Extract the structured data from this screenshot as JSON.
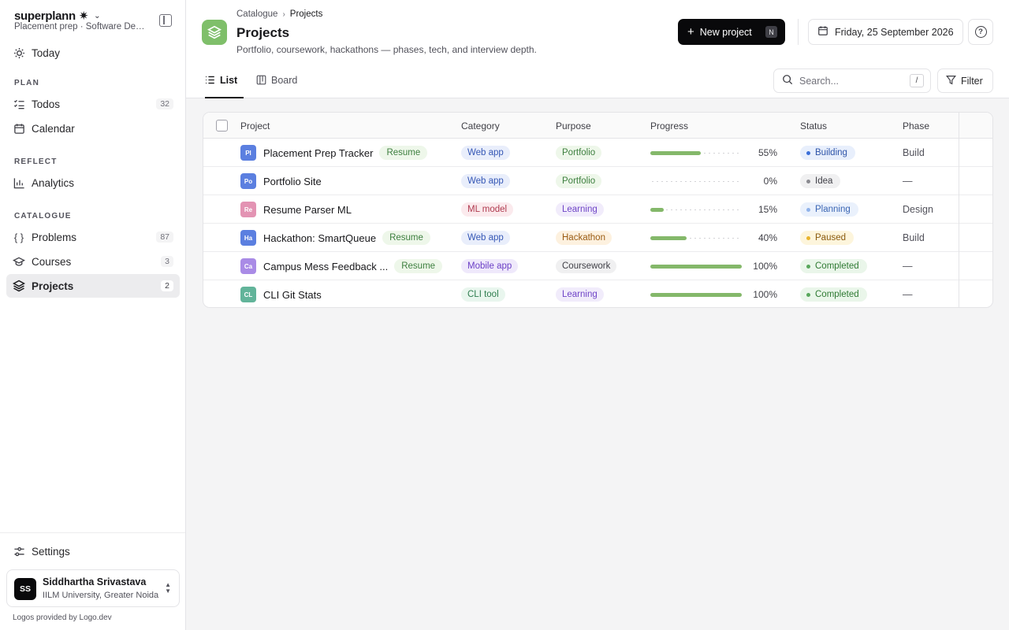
{
  "app": {
    "brand": "superplann",
    "workspace": "Placement prep · Software Development",
    "logos_note": "Logos provided by Logo.dev"
  },
  "sidebar": {
    "top": [
      {
        "label": "Today",
        "icon": "sun-icon"
      }
    ],
    "sections": [
      {
        "label": "PLAN",
        "items": [
          {
            "label": "Todos",
            "count": "32",
            "icon": "checklist-icon"
          },
          {
            "label": "Calendar",
            "count": "",
            "icon": "calendar-icon"
          }
        ]
      },
      {
        "label": "REFLECT",
        "items": [
          {
            "label": "Analytics",
            "count": "",
            "icon": "bar-chart-icon"
          }
        ]
      },
      {
        "label": "CATALOGUE",
        "items": [
          {
            "label": "Problems",
            "count": "87",
            "icon": "braces-icon"
          },
          {
            "label": "Courses",
            "count": "3",
            "icon": "graduation-cap-icon"
          },
          {
            "label": "Projects",
            "count": "2",
            "icon": "layers-icon",
            "active": true
          }
        ]
      }
    ],
    "settings": "Settings",
    "user": {
      "initials": "SS",
      "name": "Siddhartha Srivastava",
      "org": "IILM University, Greater Noida"
    }
  },
  "header": {
    "breadcrumb": [
      "Catalogue",
      "Projects"
    ],
    "title": "Projects",
    "subtitle": "Portfolio, coursework, hackathons — phases, tech, and interview depth.",
    "new_button": "New project",
    "new_shortcut": "N",
    "date": "Friday, 25 September 2026",
    "accent": "#7fbf6a"
  },
  "tabs": [
    {
      "label": "List",
      "active": true
    },
    {
      "label": "Board",
      "active": false
    }
  ],
  "search": {
    "placeholder": "Search...",
    "shortcut": "/"
  },
  "filter_label": "Filter",
  "table": {
    "columns": [
      "Project",
      "Category",
      "Purpose",
      "Progress",
      "Status",
      "Phase"
    ],
    "rows": [
      {
        "initials": "Pl",
        "tile_color": "#5b7fe0",
        "name": "Placement Prep Tracker",
        "resume": "Resume",
        "category": "Web app",
        "category_style": "webapp",
        "purpose": "Portfolio",
        "purpose_style": "portfolio",
        "progress": 55,
        "progress_label": "55%",
        "status": "Building",
        "status_style": "building",
        "phase": "Build"
      },
      {
        "initials": "Po",
        "tile_color": "#5b7fe0",
        "name": "Portfolio Site",
        "resume": "",
        "category": "Web app",
        "category_style": "webapp",
        "purpose": "Portfolio",
        "purpose_style": "portfolio",
        "progress": 0,
        "progress_label": "0%",
        "status": "Idea",
        "status_style": "idea",
        "phase": "—"
      },
      {
        "initials": "Re",
        "tile_color": "#e393b3",
        "name": "Resume Parser ML",
        "resume": "",
        "category": "ML model",
        "category_style": "ml",
        "purpose": "Learning",
        "purpose_style": "learning",
        "progress": 15,
        "progress_label": "15%",
        "status": "Planning",
        "status_style": "planning",
        "phase": "Design"
      },
      {
        "initials": "Ha",
        "tile_color": "#5b7fe0",
        "name": "Hackathon: SmartQueue",
        "resume": "Resume",
        "category": "Web app",
        "category_style": "webapp",
        "purpose": "Hackathon",
        "purpose_style": "hackathon",
        "progress": 40,
        "progress_label": "40%",
        "status": "Paused",
        "status_style": "paused",
        "phase": "Build"
      },
      {
        "initials": "Ca",
        "tile_color": "#a98be6",
        "name": "Campus Mess Feedback ...",
        "resume": "Resume",
        "category": "Mobile app",
        "category_style": "mobile",
        "purpose": "Coursework",
        "purpose_style": "coursework",
        "progress": 100,
        "progress_label": "100%",
        "status": "Completed",
        "status_style": "completed",
        "phase": "—"
      },
      {
        "initials": "CL",
        "tile_color": "#62b49a",
        "name": "CLI Git Stats",
        "resume": "",
        "category": "CLI tool",
        "category_style": "cli",
        "purpose": "Learning",
        "purpose_style": "learning",
        "progress": 100,
        "progress_label": "100%",
        "status": "Completed",
        "status_style": "completed",
        "phase": "—"
      }
    ]
  }
}
